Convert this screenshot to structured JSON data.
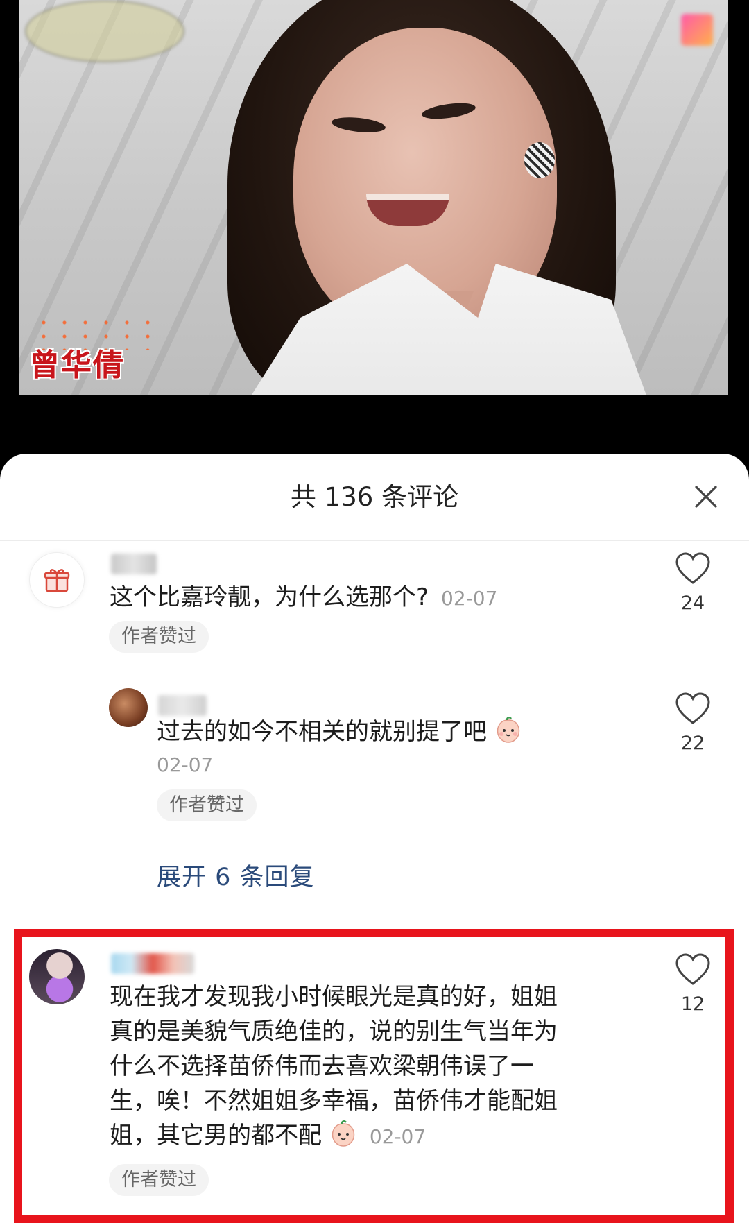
{
  "video": {
    "caption": "曾华倩"
  },
  "sheet": {
    "title": "共 136 条评论"
  },
  "comments": [
    {
      "text": "这个比嘉玲靓，为什么选那个?",
      "time": "02-07",
      "badge": "作者赞过",
      "likes": "24"
    },
    {
      "text": "过去的如今不相关的就别提了吧",
      "time": "02-07",
      "badge": "作者赞过",
      "likes": "22"
    },
    {
      "text_lines": [
        "现在我才发现我小时候眼光是真的好，姐姐",
        "真的是美貌气质绝佳的，说的别生气当年为",
        "什么不选择苗侨伟而去喜欢梁朝伟误了一",
        "生，唉！不然姐姐多幸福，苗侨伟才能配姐",
        "姐，其它男的都不配"
      ],
      "time": "02-07",
      "badge": "作者赞过",
      "likes": "12"
    }
  ],
  "expand_replies": "展开 6 条回复",
  "icons": {
    "close": "close-icon",
    "like": "heart-outline-icon",
    "gift": "gift-icon",
    "emoji": "peach-face-emoji-icon"
  },
  "colors": {
    "highlight": "#e8141c",
    "link": "#2a4a7a",
    "caption": "#c8151b"
  }
}
